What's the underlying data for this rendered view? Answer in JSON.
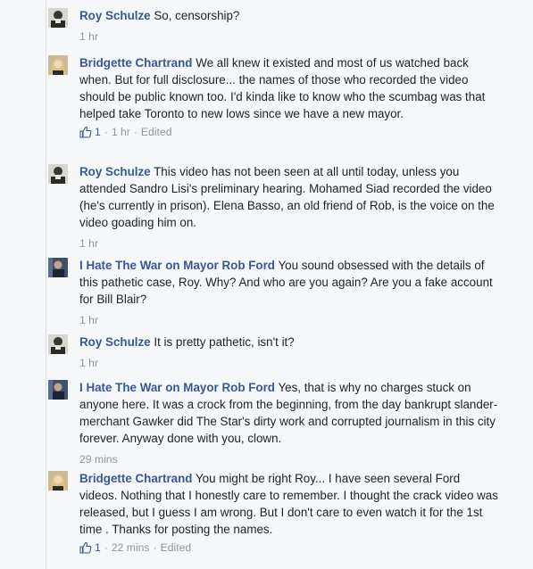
{
  "comments": [
    {
      "author": "Roy Schulze",
      "text": "So, censorship?",
      "time": "1 hr",
      "likes": "",
      "edited": ""
    },
    {
      "author": "Bridgette Chartrand",
      "text": "We all knew it existed and most of us watched back when. But for full disclosure... the names of those who recorded the video should be public known too. I'd kinda like to know who the scumbag was that helped take Toronto to new lows since we have a new mayor.",
      "time": "1 hr",
      "likes": "1",
      "edited": "Edited"
    },
    {
      "author": "Roy Schulze",
      "text": "This video has not been seen at all until today, unless you attended Sandro Lisi's preliminary hearing. Mohamed Siad recorded the video (he's currently in prison). Elena Basso, an old friend of Rob, is the voice on the video goading him on.",
      "time": "1 hr",
      "likes": "",
      "edited": ""
    },
    {
      "author": "I Hate The War on Mayor Rob Ford",
      "text": "You sound obsessed with the details of this pathetic case, Roy. Why? And who are you again? Are you a fake account for Bill Blair?",
      "time": "1 hr",
      "likes": "",
      "edited": ""
    },
    {
      "author": "Roy Schulze",
      "text": "It is pretty pathetic, isn't it?",
      "time": "1 hr",
      "likes": "",
      "edited": ""
    },
    {
      "author": "I Hate The War on Mayor Rob Ford",
      "text": "Yes, that is why no charges stuck on anyone here. It was a crock from the beginning, from the day bankrupt slander-merchant Gawker did The Star's dirty work and corrupted journalism in this city forever. Anyway done with you, clown.",
      "time": "29 mins",
      "likes": "",
      "edited": ""
    },
    {
      "author": "Bridgette Chartrand",
      "text": "You might be right Roy... I have seen several Ford videos. Nothing that I honestly care to remember. I thought the crack video was released, but I guess I am wrong. But I don't care to even watch it for the 1st time . Thanks for posting the names.",
      "time": "22 mins",
      "likes": "1",
      "edited": "Edited"
    }
  ],
  "colors": {
    "author": "#365899",
    "meta": "#90949c",
    "background": "#f6f7f9"
  }
}
